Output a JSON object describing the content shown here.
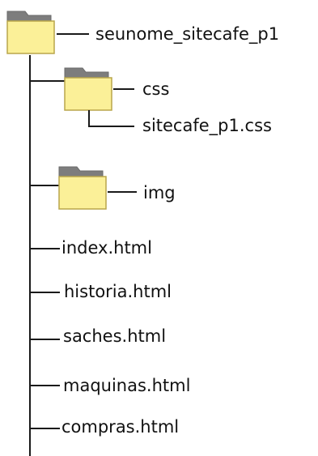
{
  "root": {
    "label": "seunome_sitecafe_p1",
    "icon": "folder-icon"
  },
  "folders": [
    {
      "label": "css",
      "icon": "folder-icon",
      "children": [
        {
          "label": "sitecafe_p1.css"
        }
      ]
    },
    {
      "label": "img",
      "icon": "folder-icon",
      "children": []
    }
  ],
  "files": [
    {
      "label": "index.html"
    },
    {
      "label": "historia.html"
    },
    {
      "label": "saches.html"
    },
    {
      "label": "maquinas.html"
    },
    {
      "label": "compras.html"
    }
  ],
  "colors": {
    "folder_body": "#fbf098",
    "folder_tab": "#7d7d7d",
    "folder_border": "#b9a64b",
    "line": "#1a1a1a",
    "text": "#111111"
  }
}
